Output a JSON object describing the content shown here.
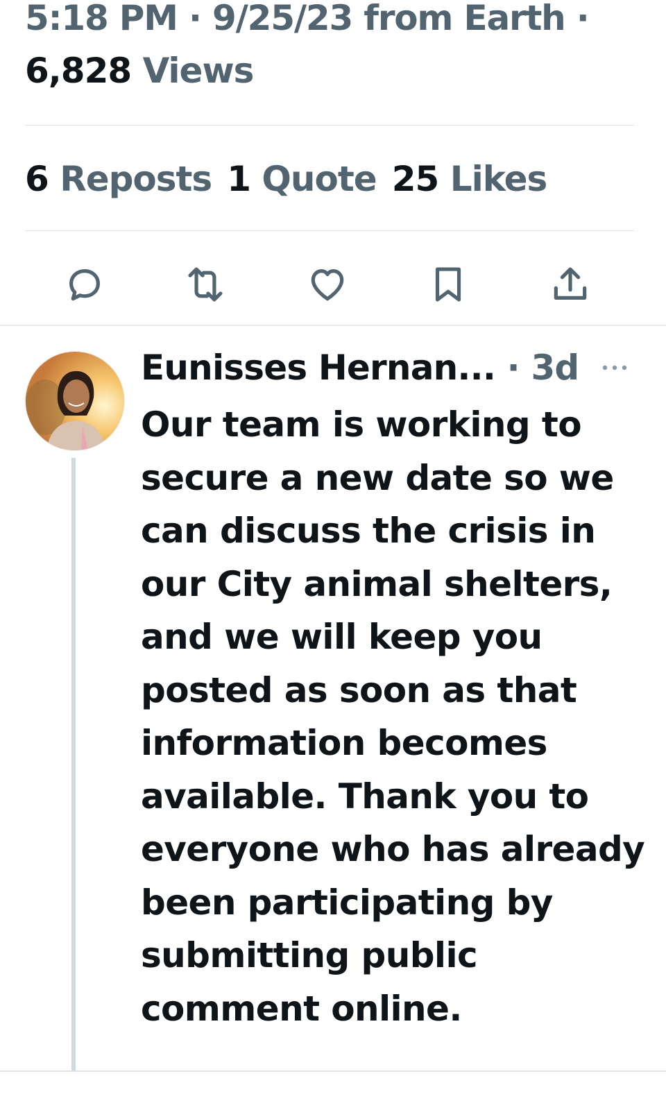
{
  "tweet": {
    "timestamp_line": "5:18 PM · 9/25/23 from Earth ·",
    "views_count": "6,828",
    "views_label": "Views",
    "stats": [
      {
        "count": "6",
        "label": "Reposts"
      },
      {
        "count": "1",
        "label": "Quote"
      },
      {
        "count": "25",
        "label": "Likes"
      }
    ],
    "actions": [
      "reply-icon",
      "repost-icon",
      "like-icon",
      "bookmark-icon",
      "share-icon"
    ]
  },
  "reply": {
    "author_name": "Eunisses Hernan...",
    "separator": " · ",
    "age": "3d",
    "text": "Our team is working to secure a new date so we can discuss the crisis in our City animal shelters, and we will keep you posted as soon as that information becomes available. Thank you to everyone who has already been participating by submitting public comment online."
  },
  "colors": {
    "primary_text": "#0f1419",
    "secondary_text": "#536471",
    "divider": "#e1e5e8",
    "thread_line": "#cfd9de"
  }
}
